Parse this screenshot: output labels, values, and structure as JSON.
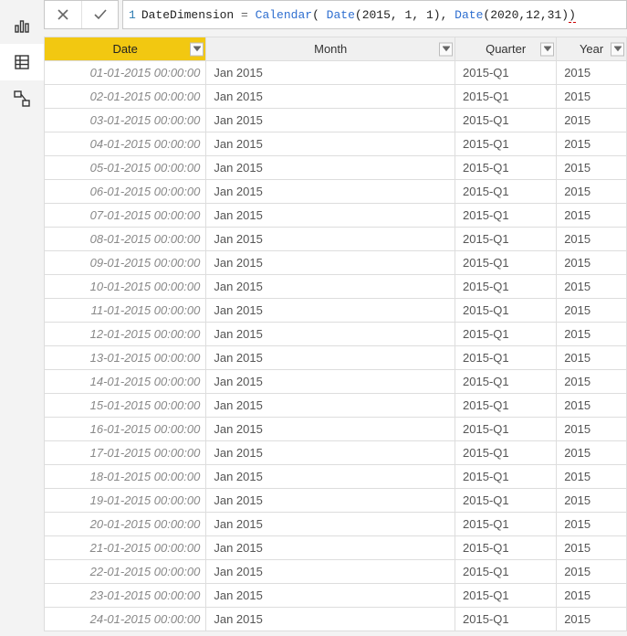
{
  "rail": {
    "items": [
      "report",
      "data",
      "model"
    ],
    "active": 1
  },
  "formula": {
    "line_no": "1",
    "tokens": [
      {
        "t": "DateDimension ",
        "cls": "tok-plain"
      },
      {
        "t": "= ",
        "cls": "tok-op"
      },
      {
        "t": "Calendar",
        "cls": "tok-func"
      },
      {
        "t": "( ",
        "cls": "tok-paren"
      },
      {
        "t": "Date",
        "cls": "tok-ident"
      },
      {
        "t": "(",
        "cls": "tok-paren"
      },
      {
        "t": "2015",
        "cls": "tok-num"
      },
      {
        "t": ", ",
        "cls": "tok-plain"
      },
      {
        "t": "1",
        "cls": "tok-num"
      },
      {
        "t": ", ",
        "cls": "tok-plain"
      },
      {
        "t": "1",
        "cls": "tok-num"
      },
      {
        "t": "), ",
        "cls": "tok-paren"
      },
      {
        "t": "Date",
        "cls": "tok-ident"
      },
      {
        "t": "(",
        "cls": "tok-paren"
      },
      {
        "t": "2020",
        "cls": "tok-num"
      },
      {
        "t": ",",
        "cls": "tok-plain"
      },
      {
        "t": "12",
        "cls": "tok-num"
      },
      {
        "t": ",",
        "cls": "tok-plain"
      },
      {
        "t": "31",
        "cls": "tok-num"
      },
      {
        "t": ")",
        "cls": "tok-paren"
      },
      {
        "t": ")",
        "cls": "tok-paren tok-err"
      }
    ]
  },
  "table": {
    "columns": [
      {
        "key": "date",
        "label": "Date",
        "cls": "col-date",
        "selected": true
      },
      {
        "key": "month",
        "label": "Month",
        "cls": "col-month",
        "selected": false
      },
      {
        "key": "quarter",
        "label": "Quarter",
        "cls": "col-quarter",
        "selected": false
      },
      {
        "key": "year",
        "label": "Year",
        "cls": "col-year",
        "selected": false
      }
    ],
    "rows": [
      {
        "date": "01-01-2015 00:00:00",
        "month": "Jan 2015",
        "quarter": "2015-Q1",
        "year": "2015"
      },
      {
        "date": "02-01-2015 00:00:00",
        "month": "Jan 2015",
        "quarter": "2015-Q1",
        "year": "2015"
      },
      {
        "date": "03-01-2015 00:00:00",
        "month": "Jan 2015",
        "quarter": "2015-Q1",
        "year": "2015"
      },
      {
        "date": "04-01-2015 00:00:00",
        "month": "Jan 2015",
        "quarter": "2015-Q1",
        "year": "2015"
      },
      {
        "date": "05-01-2015 00:00:00",
        "month": "Jan 2015",
        "quarter": "2015-Q1",
        "year": "2015"
      },
      {
        "date": "06-01-2015 00:00:00",
        "month": "Jan 2015",
        "quarter": "2015-Q1",
        "year": "2015"
      },
      {
        "date": "07-01-2015 00:00:00",
        "month": "Jan 2015",
        "quarter": "2015-Q1",
        "year": "2015"
      },
      {
        "date": "08-01-2015 00:00:00",
        "month": "Jan 2015",
        "quarter": "2015-Q1",
        "year": "2015"
      },
      {
        "date": "09-01-2015 00:00:00",
        "month": "Jan 2015",
        "quarter": "2015-Q1",
        "year": "2015"
      },
      {
        "date": "10-01-2015 00:00:00",
        "month": "Jan 2015",
        "quarter": "2015-Q1",
        "year": "2015"
      },
      {
        "date": "11-01-2015 00:00:00",
        "month": "Jan 2015",
        "quarter": "2015-Q1",
        "year": "2015"
      },
      {
        "date": "12-01-2015 00:00:00",
        "month": "Jan 2015",
        "quarter": "2015-Q1",
        "year": "2015"
      },
      {
        "date": "13-01-2015 00:00:00",
        "month": "Jan 2015",
        "quarter": "2015-Q1",
        "year": "2015"
      },
      {
        "date": "14-01-2015 00:00:00",
        "month": "Jan 2015",
        "quarter": "2015-Q1",
        "year": "2015"
      },
      {
        "date": "15-01-2015 00:00:00",
        "month": "Jan 2015",
        "quarter": "2015-Q1",
        "year": "2015"
      },
      {
        "date": "16-01-2015 00:00:00",
        "month": "Jan 2015",
        "quarter": "2015-Q1",
        "year": "2015"
      },
      {
        "date": "17-01-2015 00:00:00",
        "month": "Jan 2015",
        "quarter": "2015-Q1",
        "year": "2015"
      },
      {
        "date": "18-01-2015 00:00:00",
        "month": "Jan 2015",
        "quarter": "2015-Q1",
        "year": "2015"
      },
      {
        "date": "19-01-2015 00:00:00",
        "month": "Jan 2015",
        "quarter": "2015-Q1",
        "year": "2015"
      },
      {
        "date": "20-01-2015 00:00:00",
        "month": "Jan 2015",
        "quarter": "2015-Q1",
        "year": "2015"
      },
      {
        "date": "21-01-2015 00:00:00",
        "month": "Jan 2015",
        "quarter": "2015-Q1",
        "year": "2015"
      },
      {
        "date": "22-01-2015 00:00:00",
        "month": "Jan 2015",
        "quarter": "2015-Q1",
        "year": "2015"
      },
      {
        "date": "23-01-2015 00:00:00",
        "month": "Jan 2015",
        "quarter": "2015-Q1",
        "year": "2015"
      },
      {
        "date": "24-01-2015 00:00:00",
        "month": "Jan 2015",
        "quarter": "2015-Q1",
        "year": "2015"
      }
    ]
  }
}
